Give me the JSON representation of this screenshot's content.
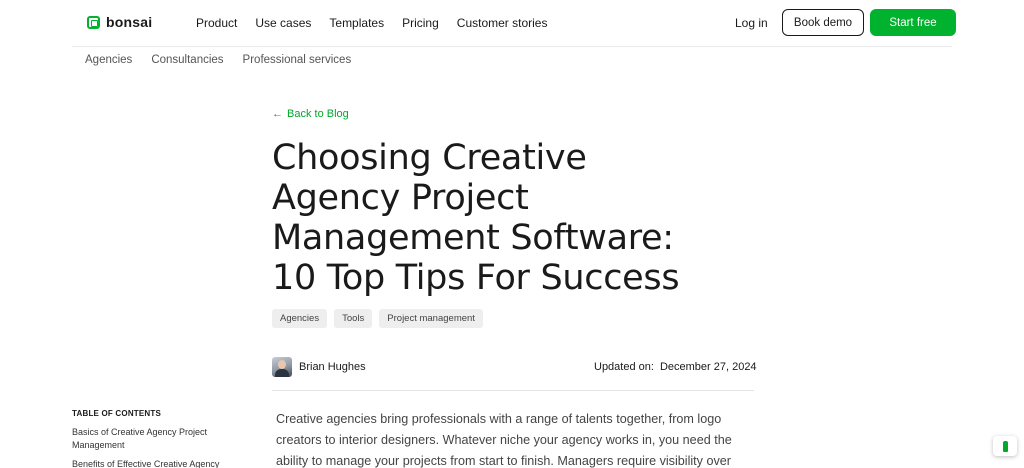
{
  "brand": {
    "name": "bonsai",
    "accent": "#00b22d"
  },
  "nav": {
    "links": [
      "Product",
      "Use cases",
      "Templates",
      "Pricing",
      "Customer stories"
    ],
    "login": "Log in",
    "book_demo": "Book demo",
    "start_free": "Start free"
  },
  "subnav": [
    "Agencies",
    "Consultancies",
    "Professional services"
  ],
  "article": {
    "back": "Back to Blog",
    "back_icon": "arrow-left-icon",
    "title_lines": [
      "Choosing Creative",
      "Agency Project",
      "Management Software:",
      "10 Top Tips For Success"
    ],
    "tags": [
      "Agencies",
      "Tools",
      "Project management"
    ],
    "author": "Brian Hughes",
    "updated_label": "Updated on:",
    "updated_date": "December 27, 2024",
    "body_lines": [
      "Creative agencies bring professionals with a range of talents together, from logo",
      "creators to interior designers. Whatever niche your agency works in, you need the",
      "ability to manage your projects from start to finish. Managers require visibility over"
    ]
  },
  "toc": {
    "title": "TABLE OF CONTENTS",
    "items": [
      "Basics of Creative Agency Project Management",
      "Benefits of Effective Creative Agency"
    ]
  }
}
